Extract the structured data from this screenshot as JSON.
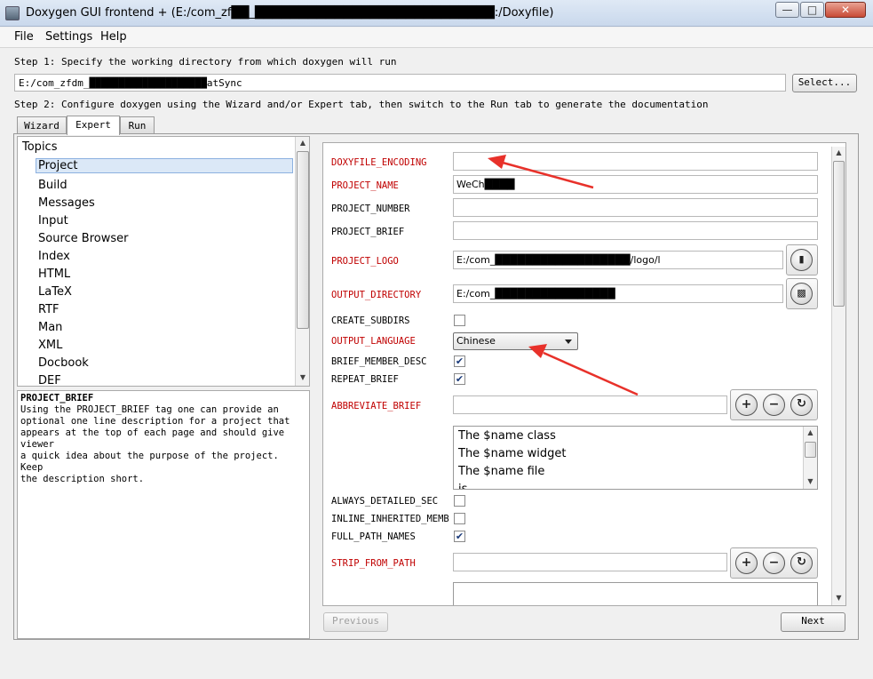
{
  "window": {
    "title": "Doxygen GUI frontend + (E:/com_zf██_███████████████████████████:/Doxyfile)"
  },
  "menu": [
    "File",
    "Settings",
    "Help"
  ],
  "step1": {
    "text": "Step 1: Specify the working directory from which doxygen will run",
    "dir_value": "E:/com_zfdm_████████████████████atSync",
    "select_label": "Select..."
  },
  "step2": {
    "text": "Step 2: Configure doxygen using the Wizard and/or Expert tab, then switch to the Run tab to generate the documentation"
  },
  "tabs": [
    "Wizard",
    "Expert",
    "Run"
  ],
  "topics": {
    "header": "Topics",
    "items": [
      "Project",
      "Build",
      "Messages",
      "Input",
      "Source Browser",
      "Index",
      "HTML",
      "LaTeX",
      "RTF",
      "Man",
      "XML",
      "Docbook",
      "DEF"
    ]
  },
  "help": {
    "title": "PROJECT_BRIEF",
    "body": "Using the PROJECT_BRIEF tag one can provide an\noptional one line description for a project that\nappears at the top of each page and should give viewer\na quick idea about the purpose of the project. Keep\nthe description short."
  },
  "settings": {
    "doxyfile_encoding": {
      "label": "DOXYFILE_ENCODING",
      "value": ""
    },
    "project_name": {
      "label": "PROJECT_NAME",
      "value": "WeCh████"
    },
    "project_number": {
      "label": "PROJECT_NUMBER",
      "value": ""
    },
    "project_brief": {
      "label": "PROJECT_BRIEF",
      "value": ""
    },
    "project_logo": {
      "label": "PROJECT_LOGO",
      "value": "E:/com_██████████████████/logo/l"
    },
    "output_directory": {
      "label": "OUTPUT_DIRECTORY",
      "value": "E:/com_████████████████"
    },
    "create_subdirs": {
      "label": "CREATE_SUBDIRS",
      "checked": false
    },
    "output_language": {
      "label": "OUTPUT_LANGUAGE",
      "value": "Chinese"
    },
    "brief_member_desc": {
      "label": "BRIEF_MEMBER_DESC",
      "checked": true
    },
    "repeat_brief": {
      "label": "REPEAT_BRIEF",
      "checked": true
    },
    "abbreviate_brief": {
      "label": "ABBREVIATE_BRIEF",
      "value": "",
      "list": [
        "The $name class",
        "The $name widget",
        "The $name file",
        "is"
      ]
    },
    "always_detailed_sec": {
      "label": "ALWAYS_DETAILED_SEC",
      "checked": false
    },
    "inline_inherited_memb": {
      "label": "INLINE_INHERITED_MEMB",
      "checked": false
    },
    "full_path_names": {
      "label": "FULL_PATH_NAMES",
      "checked": true
    },
    "strip_from_path": {
      "label": "STRIP_FROM_PATH",
      "value": ""
    }
  },
  "nav": {
    "previous_label": "Previous",
    "next_label": "Next"
  },
  "colors": {
    "modified_label": "#c00000",
    "annotation_arrow": "#e8312a",
    "selection": "#dbe8f7"
  },
  "icons": [
    "app-icon",
    "minimize-icon",
    "maximize-icon",
    "close-icon",
    "file-icon",
    "folder-icon",
    "plus-icon",
    "minus-icon",
    "refresh-icon",
    "combo-arrow-icon",
    "check-icon"
  ]
}
